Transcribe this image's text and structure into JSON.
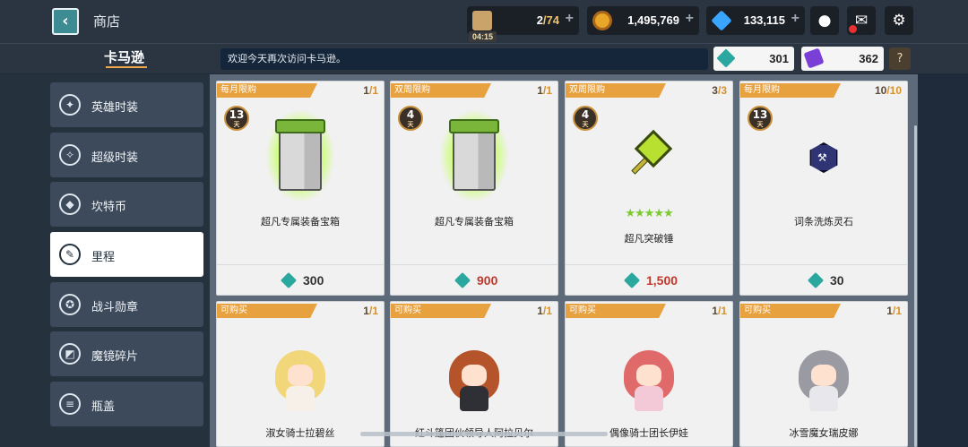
{
  "header": {
    "title": "商店",
    "back_icon": "chevron-left-icon"
  },
  "resources": {
    "stamina": {
      "current": "2",
      "max": "/74",
      "timer": "04:15",
      "icon": "coffee-cup-icon"
    },
    "gold": {
      "value": "1,495,769",
      "icon": "gold-coin-icon"
    },
    "gems": {
      "value": "133,115",
      "icon": "blue-gem-icon"
    }
  },
  "top_buttons": {
    "chat": "speech-bubble-icon",
    "mail": "envelope-icon",
    "settings": "gear-icon"
  },
  "subbar": {
    "shop_name": "卡马逊",
    "welcome": "欢迎今天再次访问卡马逊。",
    "mileage_value": "301",
    "ticket_value": "362",
    "help": "?"
  },
  "sidebar": {
    "items": [
      {
        "label": "英雄时装",
        "icon": "costume-icon",
        "glyph": "✦"
      },
      {
        "label": "超级时装",
        "icon": "super-costume-icon",
        "glyph": "✧"
      },
      {
        "label": "坎特币",
        "icon": "coin-hex-icon",
        "glyph": "◆"
      },
      {
        "label": "里程",
        "icon": "ticket-icon",
        "glyph": "✎"
      },
      {
        "label": "战斗勋章",
        "icon": "medal-icon",
        "glyph": "✪"
      },
      {
        "label": "魔镜碎片",
        "icon": "mirror-shard-icon",
        "glyph": "◩"
      },
      {
        "label": "瓶盖",
        "icon": "bottle-cap-icon",
        "glyph": "≡"
      }
    ],
    "active_index": 3
  },
  "cards": [
    {
      "tag": "每月限购",
      "limit_cur": "1",
      "limit_max": "/1",
      "days": "13",
      "days_unit": "天",
      "name": "超凡专属装备宝箱",
      "price": "300",
      "price_red": false
    },
    {
      "tag": "双周限购",
      "limit_cur": "1",
      "limit_max": "/1",
      "days": "4",
      "days_unit": "天",
      "name": "超凡专属装备宝箱",
      "price": "900",
      "price_red": true
    },
    {
      "tag": "双周限购",
      "limit_cur": "3",
      "limit_max": "/3",
      "days": "4",
      "days_unit": "天",
      "name": "超凡突破锤",
      "stars": "★★★★★",
      "price": "1,500",
      "price_red": true
    },
    {
      "tag": "每月限购",
      "limit_cur": "10",
      "limit_max": "/10",
      "days": "13",
      "days_unit": "天",
      "name": "词条洗炼灵石",
      "price": "30",
      "price_red": false
    },
    {
      "tag": "可购买",
      "limit_cur": "1",
      "limit_max": "/1",
      "name": "淑女骑士拉碧丝"
    },
    {
      "tag": "可购买",
      "limit_cur": "1",
      "limit_max": "/1",
      "name": "红斗篷团伙领导人阿拉贝尔"
    },
    {
      "tag": "可购买",
      "limit_cur": "1",
      "limit_max": "/1",
      "name": "偶像骑士团长伊娃"
    },
    {
      "tag": "可购买",
      "limit_cur": "1",
      "limit_max": "/1",
      "name": "冰雪魔女瑞皮娜"
    }
  ],
  "colors": {
    "tag_orange": "#e8a13f",
    "price_red": "#c0392b",
    "mileage_teal": "#2aa8a0",
    "active_tab": "#ffffff"
  }
}
